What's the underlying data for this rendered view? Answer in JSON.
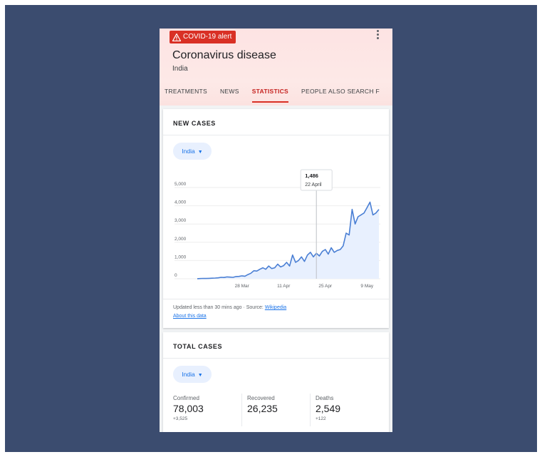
{
  "alert": {
    "label": "COVID-19 alert"
  },
  "header": {
    "title": "Coronavirus disease",
    "subtitle": "India"
  },
  "tabs": [
    {
      "label": "TREATMENTS",
      "active": false
    },
    {
      "label": "NEWS",
      "active": false
    },
    {
      "label": "STATISTICS",
      "active": true
    },
    {
      "label": "PEOPLE ALSO SEARCH F",
      "active": false
    }
  ],
  "new_cases": {
    "title": "NEW CASES",
    "region": "India",
    "footnote": "Updated less than 30 mins ago",
    "source_label": "Source:",
    "source_link": "Wikipedia",
    "about_link": "About this data"
  },
  "chart_data": {
    "type": "area",
    "title": "",
    "xlabel": "",
    "ylabel": "",
    "ylim": [
      0,
      5000
    ],
    "yticks": [
      0,
      1000,
      2000,
      3000,
      4000,
      5000
    ],
    "ytick_labels": [
      "0",
      "1,000",
      "2,000",
      "3,000",
      "4,000",
      "5,000"
    ],
    "xtick_labels": [
      "28 Mar",
      "11 Apr",
      "25 Apr",
      "9 May"
    ],
    "x": [
      "13 Mar",
      "14 Mar",
      "15 Mar",
      "16 Mar",
      "17 Mar",
      "18 Mar",
      "19 Mar",
      "20 Mar",
      "21 Mar",
      "22 Mar",
      "23 Mar",
      "24 Mar",
      "25 Mar",
      "26 Mar",
      "27 Mar",
      "28 Mar",
      "29 Mar",
      "30 Mar",
      "31 Mar",
      "1 Apr",
      "2 Apr",
      "3 Apr",
      "4 Apr",
      "5 Apr",
      "6 Apr",
      "7 Apr",
      "8 Apr",
      "9 Apr",
      "10 Apr",
      "11 Apr",
      "12 Apr",
      "13 Apr",
      "14 Apr",
      "15 Apr",
      "16 Apr",
      "17 Apr",
      "18 Apr",
      "19 Apr",
      "20 Apr",
      "21 Apr",
      "22 Apr",
      "23 Apr",
      "24 Apr",
      "25 Apr",
      "26 Apr",
      "27 Apr",
      "28 Apr",
      "29 Apr",
      "30 Apr",
      "1 May",
      "2 May",
      "3 May",
      "4 May",
      "5 May",
      "6 May",
      "7 May",
      "8 May",
      "9 May",
      "10 May",
      "11 May",
      "12 May",
      "13 May"
    ],
    "values": [
      5,
      10,
      20,
      15,
      25,
      30,
      40,
      50,
      80,
      70,
      100,
      90,
      80,
      120,
      130,
      160,
      140,
      230,
      300,
      440,
      420,
      520,
      600,
      520,
      700,
      560,
      600,
      800,
      650,
      720,
      900,
      700,
      1300,
      900,
      1000,
      1200,
      950,
      1300,
      1450,
      1200,
      1400,
      1250,
      1500,
      1600,
      1350,
      1700,
      1450,
      1550,
      1600,
      1800,
      2500,
      2400,
      3800,
      3000,
      3400,
      3500,
      3600,
      3900,
      4200,
      3500,
      3600,
      3800
    ],
    "tooltip": {
      "value": "1,486",
      "date": "22 April",
      "x": "22 Apr"
    },
    "colors": {
      "line": "#4a7fd4",
      "fill": "#e8f0fe",
      "grid": "#eeeeee"
    }
  },
  "total_cases": {
    "title": "TOTAL CASES",
    "region": "India",
    "stats": [
      {
        "label": "Confirmed",
        "value": "78,003",
        "delta": "+3,525"
      },
      {
        "label": "Recovered",
        "value": "26,235",
        "delta": ""
      },
      {
        "label": "Deaths",
        "value": "2,549",
        "delta": "+122"
      }
    ]
  }
}
